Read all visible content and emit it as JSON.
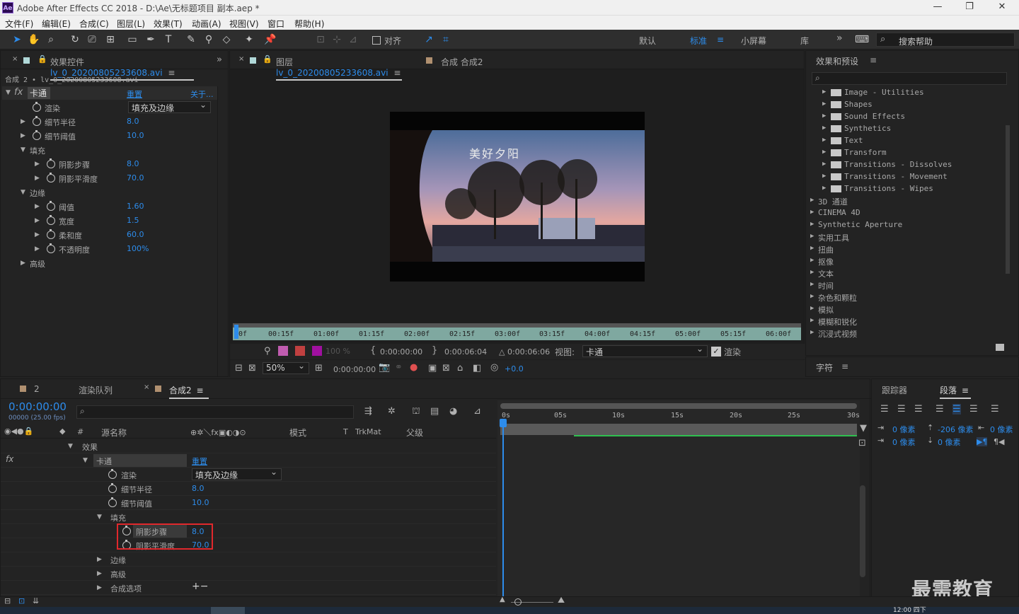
{
  "window": {
    "logo": "Ae",
    "title": "Adobe After Effects CC 2018 - D:\\Ae\\无标题项目 副本.aep *",
    "minimize": "—",
    "restore": "❐",
    "close": "✕"
  },
  "menu": [
    "文件(F)",
    "编辑(E)",
    "合成(C)",
    "图层(L)",
    "效果(T)",
    "动画(A)",
    "视图(V)",
    "窗口",
    "帮助(H)"
  ],
  "toolbar": {
    "align_label": "对齐",
    "workspaces": [
      "默认",
      "标准",
      "小屏幕",
      "库"
    ],
    "active_workspace": "标准",
    "more": "»",
    "search_help": "搜索帮助"
  },
  "effect_controls": {
    "tab_label": "效果控件",
    "tab_file": "lv_0_20200805233608.avi",
    "breadcrumb": "合成 2 • lv_0_20200805233608.avi",
    "fx_label": "fx",
    "effect_name": "卡通",
    "reset": "重置",
    "about": "关于...",
    "render_label": "渲染",
    "render_value": "填充及边缘",
    "detail_radius_label": "细节半径",
    "detail_radius": "8.0",
    "detail_threshold_label": "细节阈值",
    "detail_threshold": "10.0",
    "fill_label": "填充",
    "shading_steps_label": "阴影步骤",
    "shading_steps": "8.0",
    "shading_smooth_label": "阴影平滑度",
    "shading_smooth": "70.0",
    "edge_label": "边缘",
    "threshold_label": "阈值",
    "threshold": "1.60",
    "width_label": "宽度",
    "width": "1.5",
    "softness_label": "柔和度",
    "softness": "60.0",
    "opacity_label": "不透明度",
    "opacity": "100%",
    "advanced_label": "高级"
  },
  "viewer": {
    "tab_label": "图层",
    "tab_file": "lv_0_20200805233608.avi",
    "comp_tab": "合成 合成2",
    "overlay_text": "美好夕阳",
    "ruler_marks": [
      "0f",
      "00:15f",
      "01:00f",
      "01:15f",
      "02:00f",
      "02:15f",
      "03:00f",
      "03:15f",
      "04:00f",
      "04:15f",
      "05:00f",
      "05:15f",
      "06:00f"
    ],
    "pct": "100 %",
    "in_time": "0:00:00:00",
    "out_time": "0:00:06:04",
    "duration": "△ 0:00:06:06",
    "view_label": "视图:",
    "view_value": "卡通",
    "render_label": "渲染",
    "zoom": "50%",
    "current_time": "0:00:00:00",
    "exposure": "+0.0"
  },
  "effects_presets": {
    "title": "效果和预设",
    "items": [
      {
        "label": "Image - Utilities",
        "folder": true
      },
      {
        "label": "Shapes",
        "folder": true
      },
      {
        "label": "Sound Effects",
        "folder": true
      },
      {
        "label": "Synthetics",
        "folder": true
      },
      {
        "label": "Text",
        "folder": true
      },
      {
        "label": "Transform",
        "folder": true
      },
      {
        "label": "Transitions - Dissolves",
        "folder": true
      },
      {
        "label": "Transitions - Movement",
        "folder": true
      },
      {
        "label": "Transitions - Wipes",
        "folder": true
      },
      {
        "label": "3D 通道",
        "folder": false
      },
      {
        "label": "CINEMA 4D",
        "folder": false
      },
      {
        "label": "Synthetic Aperture",
        "folder": false
      },
      {
        "label": "实用工具",
        "folder": false
      },
      {
        "label": "扭曲",
        "folder": false
      },
      {
        "label": "抠像",
        "folder": false
      },
      {
        "label": "文本",
        "folder": false
      },
      {
        "label": "时间",
        "folder": false
      },
      {
        "label": "杂色和颗粒",
        "folder": false
      },
      {
        "label": "模拟",
        "folder": false
      },
      {
        "label": "模糊和锐化",
        "folder": false
      },
      {
        "label": "沉浸式视频",
        "folder": false
      }
    ]
  },
  "character": {
    "title": "字符"
  },
  "timeline": {
    "tabs": [
      "2",
      "渲染队列",
      "合成2"
    ],
    "timecode": "0:00:00:00",
    "fps": "00000 (25.00 fps)",
    "col_hash": "#",
    "col_source": "源名称",
    "col_mode": "模式",
    "col_t": "T",
    "col_trkmat": "TrkMat",
    "col_parent": "父级",
    "rows": {
      "effects": "效果",
      "cartoon": "卡通",
      "reset": "重置",
      "render": "渲染",
      "render_value": "填充及边缘",
      "detail_radius": "细节半径",
      "detail_radius_val": "8.0",
      "detail_threshold": "细节阈值",
      "detail_threshold_val": "10.0",
      "fill": "填充",
      "shading_steps": "阴影步骤",
      "shading_steps_val": "8.0",
      "shading_smooth": "阴影平滑度",
      "shading_smooth_val": "70.0",
      "edge": "边缘",
      "advanced": "高级",
      "comp_options": "合成选项",
      "plus_minus": "+−"
    },
    "ruler": [
      "0s",
      "05s",
      "10s",
      "15s",
      "20s",
      "25s",
      "30s"
    ]
  },
  "tracker": {
    "tab": "跟踪器"
  },
  "paragraph": {
    "tab": "段落",
    "indent_left": "0 像素",
    "space_before": "-206 像素",
    "indent_right": "0 像素",
    "indent_first": "0 像素",
    "space_after": "0 像素"
  },
  "watermark": "最需教育",
  "taskbar_time": "12:00 四下"
}
